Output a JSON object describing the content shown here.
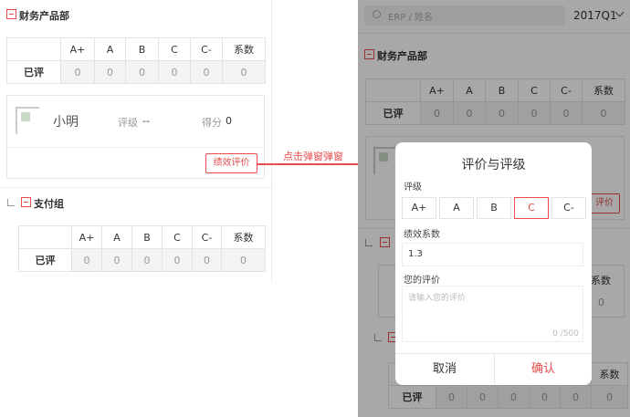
{
  "grade_headers": [
    "A+",
    "A",
    "B",
    "C",
    "C-",
    "系数"
  ],
  "left": {
    "dept_title": "财务产品部",
    "table_row_label": "已评",
    "table_values": [
      "0",
      "0",
      "0",
      "0",
      "0",
      "0"
    ],
    "employee": {
      "name": "小明",
      "rating_label": "评级",
      "rating_value": "--",
      "score_label": "得分",
      "score_value": "0",
      "eval_button": "绩效评价"
    },
    "group_title": "支付组",
    "group_row_label": "已评",
    "group_values": [
      "0",
      "0",
      "0",
      "0",
      "0",
      "0"
    ]
  },
  "annotation": {
    "text": "点击弹窗弹窗",
    "color": "#e84b4b"
  },
  "right": {
    "search_placeholder": "ERP / 姓名",
    "period": "2017Q1",
    "dept_title": "财务产品部",
    "table_row_label": "已评",
    "table_values": [
      "0",
      "0",
      "0",
      "0",
      "0",
      "0"
    ],
    "eval_button_partial": "评价",
    "header_partial": "系数",
    "bottom_row_label": "已评",
    "bottom_values": [
      "0",
      "0",
      "0",
      "0",
      "0",
      "0"
    ]
  },
  "modal": {
    "title": "评价与评级",
    "grade_label": "评级",
    "grades": [
      "A+",
      "A",
      "B",
      "C",
      "C-"
    ],
    "selected_grade": "C",
    "coef_label": "绩效系数",
    "coef_value": "1.3",
    "comment_label": "您的评价",
    "comment_placeholder": "请输入您的评价",
    "char_count": "0 /500",
    "cancel": "取消",
    "confirm": "确认"
  },
  "colors": {
    "accent": "#e84b4b",
    "border": "#e3e3e3",
    "overlay": "rgba(0,0,0,0.34)"
  }
}
